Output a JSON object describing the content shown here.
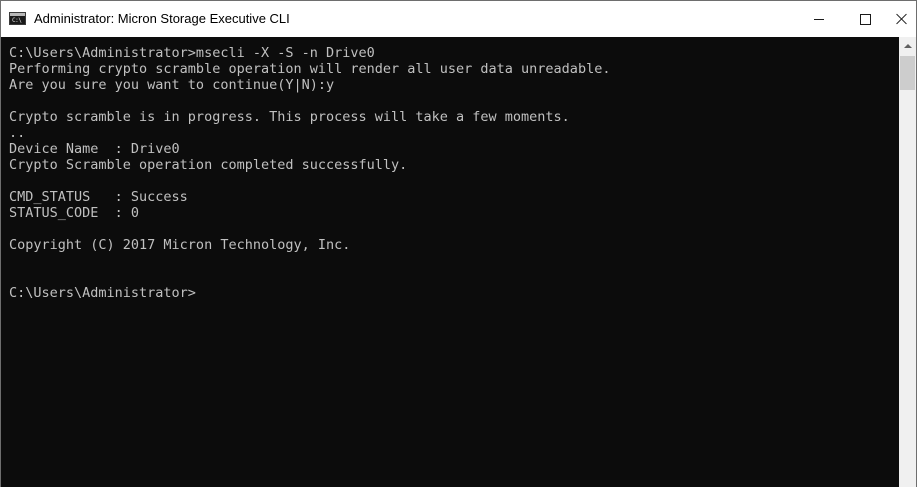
{
  "window": {
    "title": "Administrator: Micron Storage Executive CLI",
    "icon": "console-icon",
    "icon_prompt": "C:\\",
    "controls": {
      "minimize": "minimize-icon",
      "maximize": "maximize-icon",
      "close": "close-icon"
    }
  },
  "console": {
    "background": "#0c0c0c",
    "foreground": "#c0c0c0",
    "lines": [
      "C:\\Users\\Administrator>msecli -X -S -n Drive0",
      "Performing crypto scramble operation will render all user data unreadable.",
      "Are you sure you want to continue(Y|N):y",
      "",
      "Crypto scramble is in progress. This process will take a few moments.",
      "..",
      "Device Name  : Drive0",
      "Crypto Scramble operation completed successfully.",
      "",
      "CMD_STATUS   : Success",
      "STATUS_CODE  : 0",
      "",
      "Copyright (C) 2017 Micron Technology, Inc.",
      "",
      "",
      "C:\\Users\\Administrator>"
    ]
  }
}
